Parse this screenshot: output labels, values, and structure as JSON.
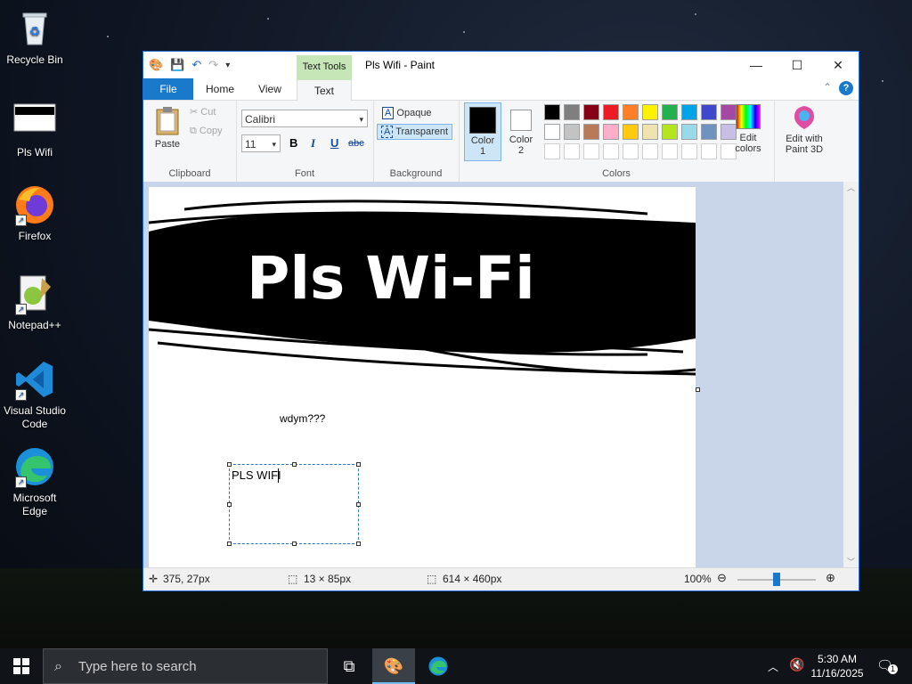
{
  "desktop": {
    "icons": [
      {
        "label": "Recycle Bin"
      },
      {
        "label": "Pls Wifi"
      },
      {
        "label": "Firefox"
      },
      {
        "label": "Notepad++"
      },
      {
        "label": "Visual Studio Code"
      },
      {
        "label": "Microsoft Edge"
      }
    ]
  },
  "window": {
    "title": "Pls Wifi - Paint",
    "context_tab": "Text Tools",
    "minimize": "—",
    "maximize": "☐",
    "close": "✕"
  },
  "tabs": {
    "file": "File",
    "home": "Home",
    "view": "View",
    "text": "Text"
  },
  "ribbon": {
    "clipboard": {
      "paste": "Paste",
      "cut": "Cut",
      "copy": "Copy",
      "label": "Clipboard"
    },
    "font": {
      "family": "Calibri",
      "size": "11",
      "bold": "B",
      "italic": "I",
      "underline": "U",
      "strike": "abc",
      "label": "Font"
    },
    "background": {
      "opaque": "Opaque",
      "transparent": "Transparent",
      "label": "Background"
    },
    "colors": {
      "color1": "Color 1",
      "color2": "Color 2",
      "edit": "Edit colors",
      "label": "Colors",
      "color1_value": "#000000",
      "color2_value": "#ffffff",
      "palette_row1": [
        "#000000",
        "#7f7f7f",
        "#880015",
        "#ed1c24",
        "#ff7f27",
        "#fff200",
        "#22b14c",
        "#00a2e8",
        "#3f48cc",
        "#a349a4"
      ],
      "palette_row2": [
        "#ffffff",
        "#c3c3c3",
        "#b97a57",
        "#ffaec9",
        "#ffc90e",
        "#efe4b0",
        "#b5e61d",
        "#99d9ea",
        "#7092be",
        "#c8bfe7"
      ]
    },
    "paint3d": {
      "label": "Edit with Paint 3D"
    }
  },
  "canvas": {
    "drawing_text": "Pls Wi-Fi",
    "reply_text": "wdym???",
    "textbox_text": "PLS WIFI"
  },
  "status": {
    "cursor": "375, 27px",
    "selection": "13 × 85px",
    "size": "614 × 460px",
    "zoom": "100%"
  },
  "taskbar": {
    "search_placeholder": "Type here to search",
    "time": "5:30 AM",
    "date": "11/16/2025",
    "notification_count": "1"
  }
}
